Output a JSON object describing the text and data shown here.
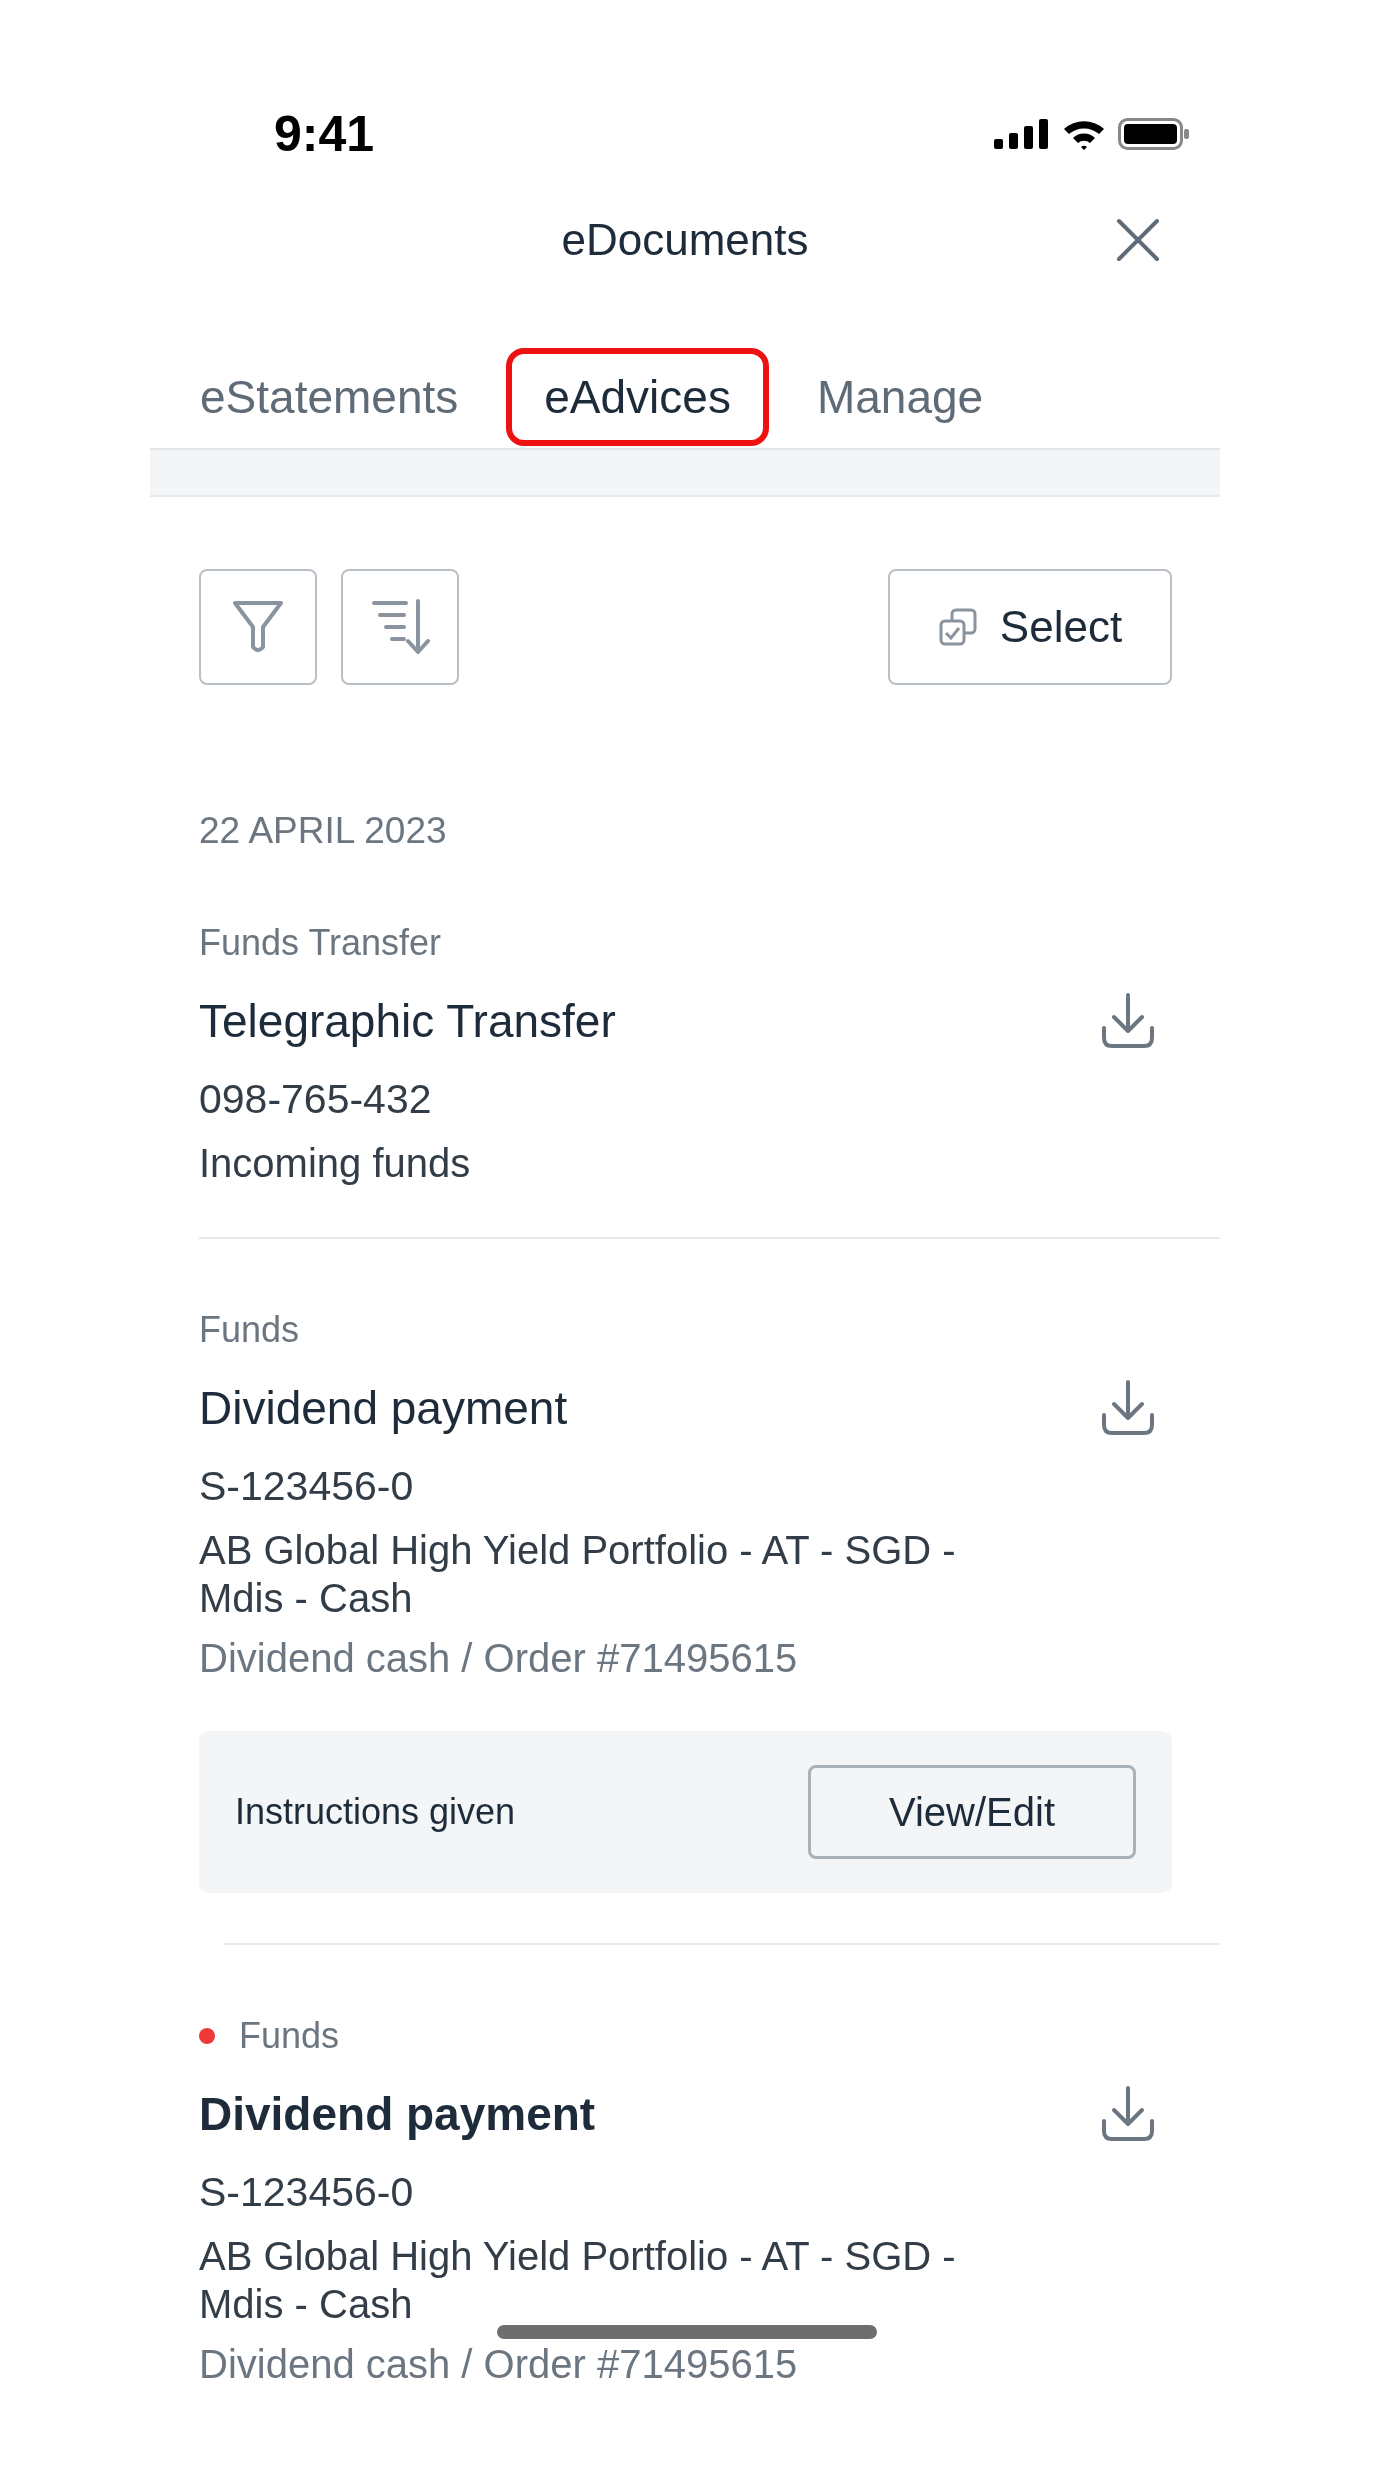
{
  "status_bar": {
    "time": "9:41"
  },
  "header": {
    "title": "eDocuments"
  },
  "tabs": [
    {
      "label": "eStatements",
      "selected": false,
      "highlighted": false
    },
    {
      "label": "eAdvices",
      "selected": true,
      "highlighted": true
    },
    {
      "label": "Manage",
      "selected": false,
      "highlighted": false
    }
  ],
  "toolbar": {
    "select_label": "Select"
  },
  "groups": [
    {
      "date": "22 APRIL 2023",
      "items": [
        {
          "category": "Funds Transfer",
          "title": "Telegraphic Transfer",
          "reference": "098-765-432",
          "description": "Incoming funds",
          "unread": false
        },
        {
          "category": "Funds",
          "title": "Dividend payment",
          "reference": "S-123456-0",
          "description": "AB Global High Yield Portfolio - AT - SGD - Mdis - Cash",
          "meta": "Dividend cash / Order #71495615",
          "unread": false,
          "instructions": {
            "text": "Instructions given",
            "button": "View/Edit"
          }
        },
        {
          "category": "Funds",
          "title": "Dividend payment",
          "reference": "S-123456-0",
          "description": "AB Global High Yield Portfolio - AT - SGD - Mdis - Cash",
          "meta": "Dividend cash / Order #71495615",
          "unread": true
        }
      ]
    }
  ]
}
